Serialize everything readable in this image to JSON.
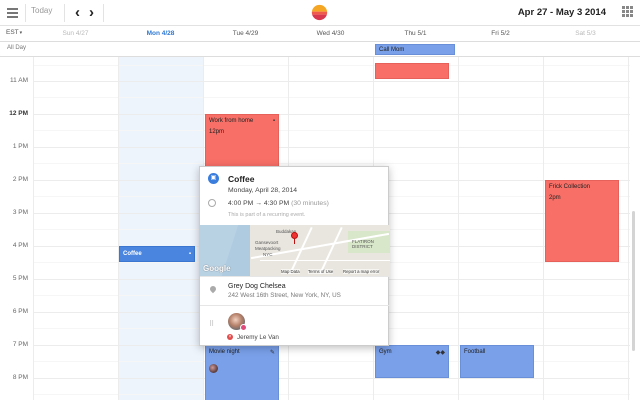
{
  "toolbar": {
    "today_label": "Today",
    "prev_label": "‹",
    "next_label": "›",
    "date_range": "Apr 27 - May 3 2014"
  },
  "timezone": {
    "label": "EST",
    "caret": "▾"
  },
  "days": [
    {
      "label": "Sun 4/27",
      "state": "weekend"
    },
    {
      "label": "Mon 4/28",
      "state": "today"
    },
    {
      "label": "Tue 4/29",
      "state": "normal"
    },
    {
      "label": "Wed 4/30",
      "state": "normal"
    },
    {
      "label": "Thu 5/1",
      "state": "normal"
    },
    {
      "label": "Fri 5/2",
      "state": "normal"
    },
    {
      "label": "Sat 5/3",
      "state": "weekend"
    }
  ],
  "allday_label": "All Day",
  "hours": [
    "11 AM",
    "12 PM",
    "1 PM",
    "2 PM",
    "3 PM",
    "4 PM",
    "5 PM",
    "6 PM",
    "7 PM",
    "8 PM"
  ],
  "events": {
    "call_mom": {
      "title": "Call Mom"
    },
    "thu_red": {
      "title": ""
    },
    "work_from_home": {
      "title": "Work from home",
      "time": "12pm"
    },
    "coffee": {
      "title": "Coffee"
    },
    "frick": {
      "title": "Frick Collection",
      "time": "2pm"
    },
    "movie_night": {
      "title": "Movie night"
    },
    "gym": {
      "title": "Gym"
    },
    "football": {
      "title": "Football"
    }
  },
  "popover": {
    "title": "Coffee",
    "date": "Monday, April 28, 2014",
    "time_range": "4:00 PM → 4:30 PM",
    "duration": "(30 minutes)",
    "recurring_note": "This is part of a recurring event.",
    "map": {
      "labels": {
        "buddakan": "Buddakan",
        "gansevoort": "Gansevoort",
        "meatpacking": "Meatpacking",
        "nyc": "NYC",
        "flatiron": "FLATIRON DISTRICT"
      },
      "google": "Google",
      "map_data": "Map Data",
      "terms": "Terms of Use",
      "report": "Report a map error"
    },
    "location_name": "Grey Dog Chelsea",
    "location_address": "242 West 16th Street, New York, NY, US",
    "attendee_name": "Jeremy Le Van"
  },
  "colors": {
    "accent": "#2d78d4",
    "event_red": "#f76f67",
    "event_blue": "#7aa0ea",
    "event_darkblue": "#4a86e0",
    "today_column": "#eef4fc"
  }
}
